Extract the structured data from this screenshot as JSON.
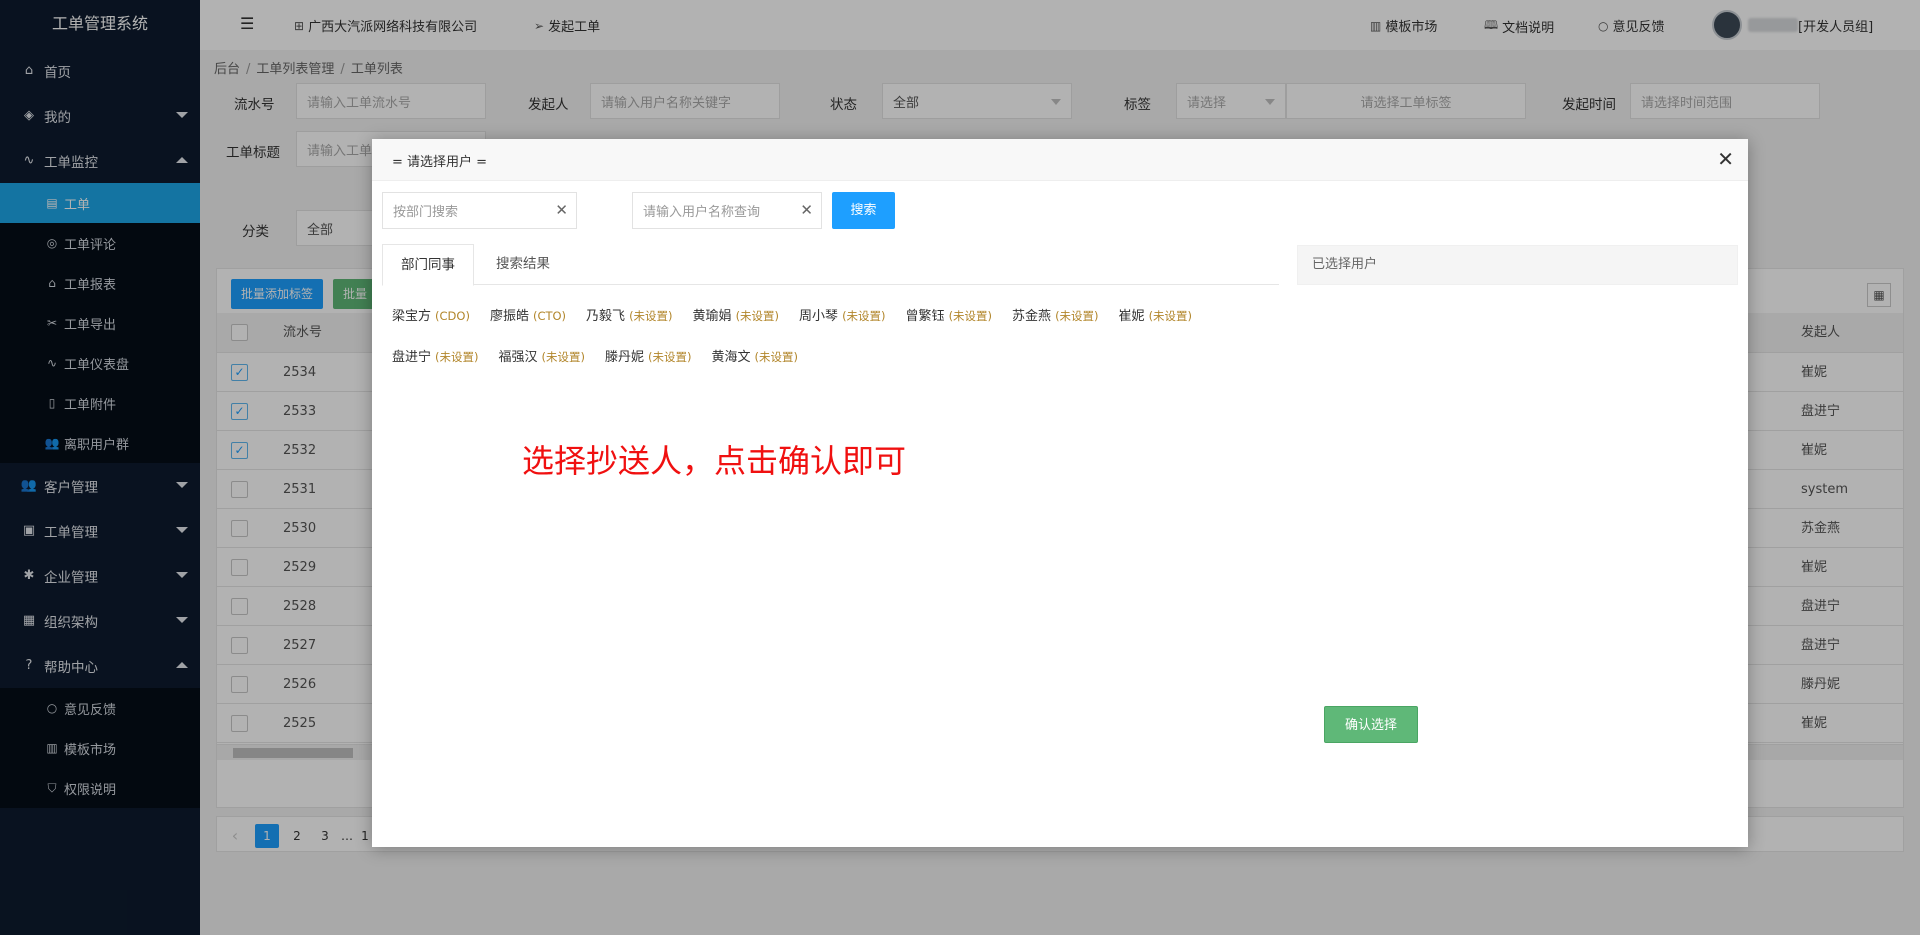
{
  "sidebar": {
    "title": "工单管理系统",
    "menu": {
      "home": {
        "label": "首页",
        "icon": "home-icon"
      },
      "mine": {
        "label": "我的",
        "icon": "layers-icon"
      },
      "monitor": {
        "label": "工单监控",
        "icon": "pulse-icon"
      },
      "customer": {
        "label": "客户管理",
        "icon": "users-icon"
      },
      "ticket_mgmt": {
        "label": "工单管理",
        "icon": "clipboard-icon"
      },
      "enterprise": {
        "label": "企业管理",
        "icon": "gear-icon"
      },
      "org": {
        "label": "组织架构",
        "icon": "building-icon"
      },
      "help": {
        "label": "帮助中心",
        "icon": "question-icon"
      }
    },
    "monitor_sub": [
      "工单",
      "工单评论",
      "工单报表",
      "工单导出",
      "工单仪表盘",
      "工单附件",
      "离职用户群"
    ],
    "help_sub": [
      "意见反馈",
      "模板市场",
      "权限说明"
    ]
  },
  "topbar": {
    "company": "广西大汽派网络科技有限公司",
    "create_ticket": "发起工单",
    "template_market": "模板市场",
    "docs": "文档说明",
    "feedback": "意见反馈",
    "user_group": "[开发人员组]"
  },
  "breadcrumb": {
    "root": "后台",
    "mid": "工单列表管理",
    "current": "工单列表"
  },
  "filters": {
    "serial_label": "流水号",
    "serial_placeholder": "请输入工单流水号",
    "initiator_label": "发起人",
    "initiator_placeholder": "请输入用户名称关键字",
    "status_label": "状态",
    "status_value": "全部",
    "tag_label": "标签",
    "tag_select": "请选择",
    "tag_placeholder": "请选择工单标签",
    "time_label": "发起时间",
    "time_placeholder": "请选择时间范围",
    "title_label": "工单标题",
    "title_placeholder": "请输入工单",
    "category_label": "分类",
    "category_value": "全部"
  },
  "table": {
    "btn_batch_add_tag": "批量添加标签",
    "btn_batch_2": "批量",
    "col_serial": "流水号",
    "col_initiator": "发起人",
    "rows": [
      {
        "serial": "2534",
        "initiator": "崔妮",
        "checked": true
      },
      {
        "serial": "2533",
        "initiator": "盘进宁",
        "checked": true
      },
      {
        "serial": "2532",
        "initiator": "崔妮",
        "checked": true
      },
      {
        "serial": "2531",
        "initiator": "system",
        "checked": false
      },
      {
        "serial": "2530",
        "initiator": "苏金燕",
        "checked": false
      },
      {
        "serial": "2529",
        "initiator": "崔妮",
        "checked": false
      },
      {
        "serial": "2528",
        "initiator": "盘进宁",
        "checked": false
      },
      {
        "serial": "2527",
        "initiator": "盘进宁",
        "checked": false
      },
      {
        "serial": "2526",
        "initiator": "滕丹妮",
        "checked": false
      },
      {
        "serial": "2525",
        "initiator": "崔妮",
        "checked": false
      }
    ]
  },
  "pager": {
    "prev": "‹",
    "p1": "1",
    "p2": "2",
    "p3": "3",
    "ellipsis": "…",
    "last": "1"
  },
  "modal": {
    "title": "= 请选择用户 =",
    "dept_search_placeholder": "按部门搜索",
    "name_search_placeholder": "请输入用户名称查询",
    "search_btn": "搜索",
    "tab_colleagues": "部门同事",
    "tab_results": "搜索结果",
    "selected_title": "已选择用户",
    "users": [
      {
        "name": "梁宝方",
        "role": "(CDO)"
      },
      {
        "name": "廖振皓",
        "role": "(CTO)"
      },
      {
        "name": "乃毅飞",
        "role": "(未设置)"
      },
      {
        "name": "黄瑜娟",
        "role": "(未设置)"
      },
      {
        "name": "周小琴",
        "role": "(未设置)"
      },
      {
        "name": "曾繁钰",
        "role": "(未设置)"
      },
      {
        "name": "苏金燕",
        "role": "(未设置)"
      },
      {
        "name": "崔妮",
        "role": "(未设置)"
      },
      {
        "name": "盘进宁",
        "role": "(未设置)"
      },
      {
        "name": "福强汉",
        "role": "(未设置)"
      },
      {
        "name": "滕丹妮",
        "role": "(未设置)"
      },
      {
        "name": "黄海文",
        "role": "(未设置)"
      }
    ],
    "annotation": "选择抄送人，点击确认即可",
    "confirm_btn": "确认选择"
  },
  "colors": {
    "sidebar_bg": "#0d1b2e",
    "active": "#1ea7e8",
    "primary": "#1e9fff",
    "green": "#5fb878",
    "annotation": "#f01010",
    "role": "#b2862b"
  }
}
